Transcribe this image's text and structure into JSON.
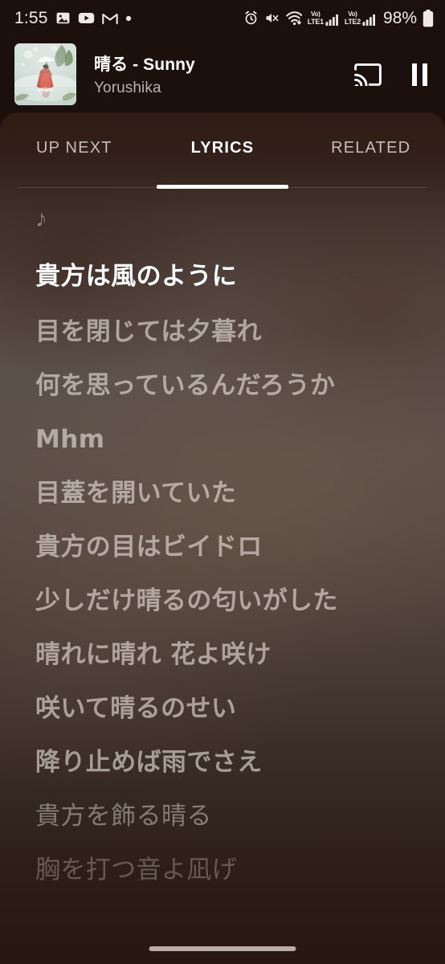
{
  "status_bar": {
    "clock": "1:55",
    "battery_percent": "98%",
    "left_icons": [
      "photos-icon",
      "youtube-icon",
      "gmail-icon",
      "dot-icon"
    ],
    "right_icons": [
      "alarm-icon",
      "mute-icon",
      "wifi-icon",
      "volte1-icon",
      "signal1-icon",
      "volte2-icon",
      "signal2-icon",
      "battery-icon"
    ],
    "volte_labels": {
      "line1_top": "Vo)",
      "line1_bottom": "LTE1",
      "line2_top": "Vo)",
      "line2_bottom": "LTE2"
    }
  },
  "player": {
    "title": "晴る - Sunny",
    "artist": "Yorushika",
    "album_art_name": "album-art-harure-sunny",
    "cast_label": "cast-icon",
    "pause_label": "pause-button"
  },
  "tabs": [
    {
      "label": "UP NEXT",
      "active": false
    },
    {
      "label": "LYRICS",
      "active": true
    },
    {
      "label": "RELATED",
      "active": false
    }
  ],
  "lyrics": {
    "note_glyph": "♪",
    "lines": [
      {
        "text": "貴方は風のように",
        "state": "current"
      },
      {
        "text": "目を閉じては夕暮れ",
        "state": "upcoming"
      },
      {
        "text": "何を思っているんだろうか",
        "state": "upcoming"
      },
      {
        "text": "Mhm",
        "state": "upcoming"
      },
      {
        "text": "目蓋を開いていた",
        "state": "upcoming"
      },
      {
        "text": "貴方の目はビイドロ",
        "state": "upcoming"
      },
      {
        "text": "少しだけ晴るの匂いがした",
        "state": "upcoming"
      },
      {
        "text": "晴れに晴れ 花よ咲け",
        "state": "upcoming"
      },
      {
        "text": "咲いて晴るのせい",
        "state": "upcoming"
      },
      {
        "text": "降り止めば雨でさえ",
        "state": "upcoming"
      },
      {
        "text": "貴方を飾る晴る",
        "state": "fade1"
      },
      {
        "text": "胸を打つ音よ凪げ",
        "state": "fade2"
      }
    ]
  },
  "colors": {
    "app_background": "#1b100c",
    "panel_top": "#2e1b14",
    "panel_mid": "#5c514a",
    "panel_bottom": "#281710",
    "active_lyric": "#ffffff",
    "inactive_lyric": "#e8e0db",
    "tab_active": "#ffffff",
    "tab_inactive": "#c8bdb8",
    "status_text": "#f2ece9"
  },
  "home_indicator": "home-indicator"
}
